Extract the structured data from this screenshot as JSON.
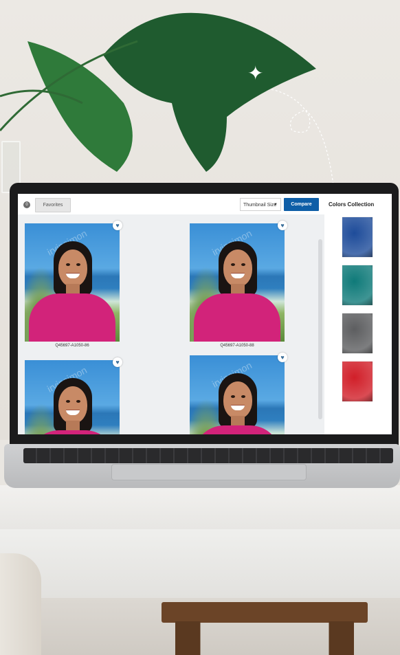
{
  "app": {
    "toolbar": {
      "badge_count": "0",
      "favorites_label": "Favorites",
      "thumbnail_size_label": "Thumbnail Size",
      "compare_label": "Compare"
    },
    "sidebar": {
      "title": "Colors Collection",
      "swatches": [
        {
          "name": "blue",
          "color": "#1e4c9a"
        },
        {
          "name": "teal",
          "color": "#0f7a79"
        },
        {
          "name": "gray",
          "color": "#5d5e60"
        },
        {
          "name": "red",
          "color": "#d11f29"
        }
      ]
    },
    "gallery": {
      "photos": [
        {
          "caption": "Q45697-A1050-86",
          "watermark": "irvinsimon"
        },
        {
          "caption": "Q45697-A1050-88",
          "watermark": "irvinsimon"
        },
        {
          "caption": "",
          "watermark": "irvinsimon"
        },
        {
          "caption": "",
          "watermark": "irvinsimon"
        }
      ]
    },
    "colors": {
      "accent": "#0e5ea7",
      "heart": "#3b6f9a"
    }
  },
  "icons": {
    "heart": "heart-icon",
    "caret": "chevron-down-icon",
    "butterfly": "butterfly-icon"
  }
}
